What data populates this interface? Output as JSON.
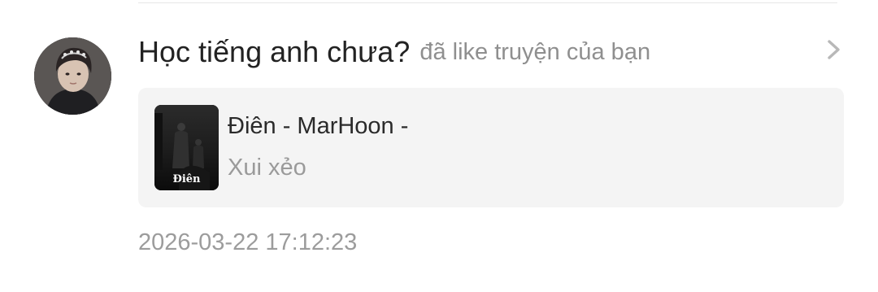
{
  "notification": {
    "username": "Học tiếng anh chưa?",
    "action": "đã like truyện của bạn",
    "timestamp": "2026-03-22 17:12:23",
    "story": {
      "title": "Điên - MarHoon -",
      "chapter": "Xui xẻo",
      "cover_text": "Điên"
    },
    "icons": {
      "avatar": "user-avatar-photo",
      "chevron": "chevron-right-icon"
    }
  }
}
